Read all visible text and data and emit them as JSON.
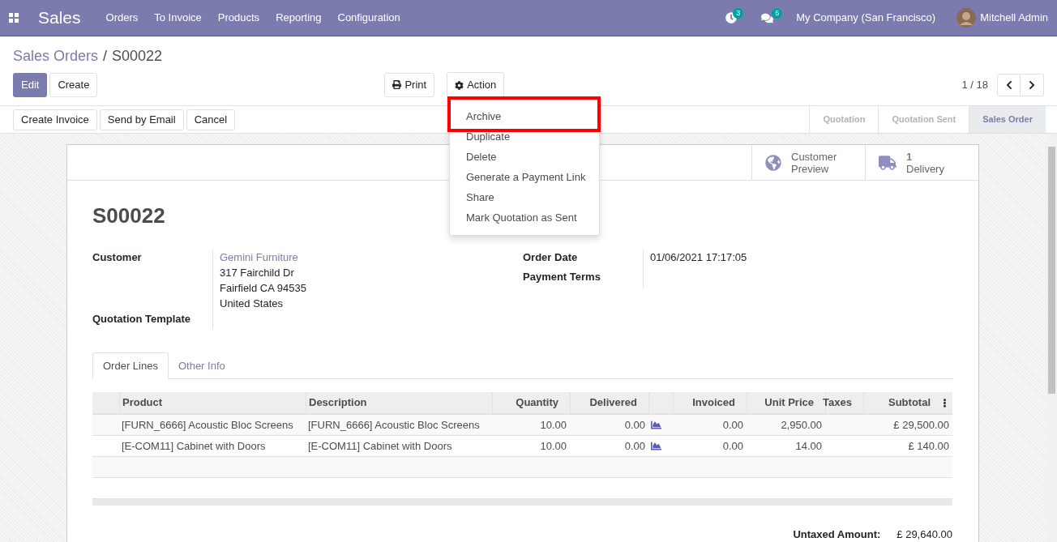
{
  "navbar": {
    "app": "Sales",
    "menu": [
      "Orders",
      "To Invoice",
      "Products",
      "Reporting",
      "Configuration"
    ],
    "activity_count": "3",
    "message_count": "5",
    "company": "My Company (San Francisco)",
    "user": "Mitchell Admin"
  },
  "breadcrumb": [
    {
      "label": "Sales Orders",
      "link": true
    },
    {
      "label": "/",
      "link": false
    },
    {
      "label": "S00022",
      "link": false
    }
  ],
  "buttons": {
    "edit": "Edit",
    "create": "Create",
    "print": "Print",
    "action": "Action"
  },
  "pager": "1 / 18",
  "action_menu": [
    {
      "label": "Archive",
      "highlighted": true
    },
    {
      "label": "Duplicate",
      "highlighted": false
    },
    {
      "label": "Delete",
      "highlighted": false
    },
    {
      "label": "Generate a Payment Link",
      "highlighted": false
    },
    {
      "label": "Share",
      "highlighted": false
    },
    {
      "label": "Mark Quotation as Sent",
      "highlighted": false
    }
  ],
  "header_buttons": [
    "Create Invoice",
    "Send by Email",
    "Cancel"
  ],
  "stages": [
    {
      "label": "Quotation",
      "selected": false
    },
    {
      "label": "Quotation Sent",
      "selected": false
    },
    {
      "label": "Sales Order",
      "selected": true
    }
  ],
  "smart_buttons": [
    {
      "kind": "globe",
      "label": "Customer",
      "sublabel": "Preview"
    },
    {
      "kind": "truck",
      "label": "1",
      "sublabel": "Delivery"
    }
  ],
  "order_name": "S00022",
  "fields_left": [
    {
      "label": "Customer",
      "lines": [
        "Gemini Furniture",
        "317 Fairchild Dr",
        "Fairfield CA 94535",
        "United States"
      ]
    },
    {
      "label": "Quotation Template"
    }
  ],
  "fields_right": [
    {
      "label": "Order Date",
      "value": "01/06/2021 17:17:05"
    },
    {
      "label": "Payment Terms"
    }
  ],
  "tabs": [
    {
      "label": "Order Lines",
      "selected": true
    },
    {
      "label": "Other Info",
      "selected": false
    }
  ],
  "table": {
    "columns": [
      "Product",
      "Description",
      "Quantity",
      "Delivered",
      "Invoiced",
      "Unit Price",
      "Taxes",
      "Subtotal"
    ],
    "rows": [
      [
        "[FURN_6666] Acoustic Bloc Screens",
        "[FURN_6666] Acoustic Bloc Screens",
        "10.00",
        "0.00",
        "0.00",
        "2,950.00",
        "",
        "£ 29,500.00"
      ],
      [
        "[E-COM11] Cabinet with Doors",
        "[E-COM11] Cabinet with Doors",
        "10.00",
        "0.00",
        "0.00",
        "14.00",
        "",
        "£ 140.00"
      ]
    ]
  },
  "totals": [
    {
      "label": "Untaxed Amount:",
      "value": "£ 29,640.00"
    }
  ]
}
